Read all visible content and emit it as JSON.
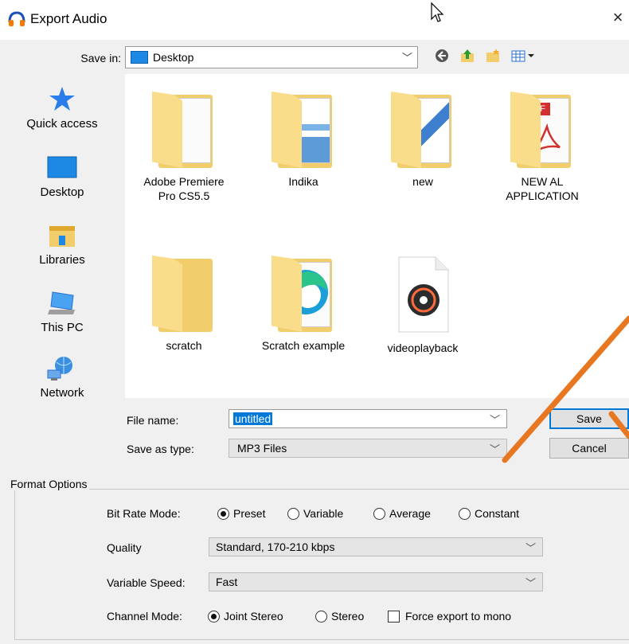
{
  "window": {
    "title": "Export Audio",
    "close_glyph": "×"
  },
  "save_in": {
    "label": "Save in:",
    "value": "Desktop",
    "toolbar": [
      "back-icon",
      "up-folder-icon",
      "new-folder-icon",
      "view-menu-icon"
    ]
  },
  "places": [
    {
      "label": "Quick access",
      "icon": "quick-access-icon"
    },
    {
      "label": "Desktop",
      "icon": "desktop-icon"
    },
    {
      "label": "Libraries",
      "icon": "libraries-icon"
    },
    {
      "label": "This PC",
      "icon": "this-pc-icon"
    },
    {
      "label": "Network",
      "icon": "network-icon"
    }
  ],
  "files": [
    {
      "line1": "Adobe Premiere",
      "line2": "Pro CS5.5",
      "kind": "folder"
    },
    {
      "line1": "Indika",
      "line2": "",
      "kind": "folder"
    },
    {
      "line1": "new",
      "line2": "",
      "kind": "folder"
    },
    {
      "line1": "NEW AL",
      "line2": "APPLICATION",
      "kind": "folder",
      "badge": "PDF"
    },
    {
      "line1": "scratch",
      "line2": "",
      "kind": "folder"
    },
    {
      "line1": "Scratch example",
      "line2": "",
      "kind": "folder"
    },
    {
      "line1": "videoplayback",
      "line2": "",
      "kind": "media-file"
    }
  ],
  "file_name": {
    "label": "File name:",
    "value": "untitled"
  },
  "save_as_type": {
    "label": "Save as type:",
    "value": "MP3 Files"
  },
  "buttons": {
    "save": "Save",
    "cancel": "Cancel"
  },
  "format_options": {
    "title": "Format Options",
    "bit_rate_mode": {
      "label": "Bit Rate Mode:",
      "options": [
        "Preset",
        "Variable",
        "Average",
        "Constant"
      ],
      "selected": "Preset"
    },
    "quality": {
      "label": "Quality",
      "value": "Standard, 170-210 kbps"
    },
    "variable_speed": {
      "label": "Variable Speed:",
      "value": "Fast"
    },
    "channel_mode": {
      "label": "Channel Mode:",
      "options": [
        "Joint Stereo",
        "Stereo"
      ],
      "selected": "Joint Stereo",
      "force_mono_label": "Force export to mono",
      "force_mono_checked": false
    }
  },
  "colors": {
    "accent": "#0078d7",
    "folder": "#f1cd6c",
    "annotation_arrow": "#e87722"
  }
}
